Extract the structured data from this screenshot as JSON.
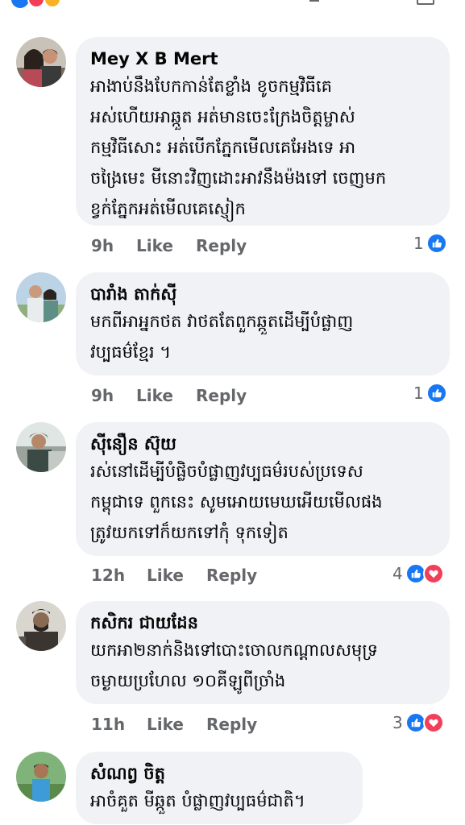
{
  "colors": {
    "like": "#1877f2",
    "love": "#f33e58",
    "bubble": "#f0f2f5",
    "meta": "#65676b"
  },
  "comments": [
    {
      "author": "Mey X B Mert",
      "text": "អាងាប់នឹងបែកកាន់តែខ្លាំង ខូចកម្មវិធីគេ\nអស់ហើយអាឆ្កួត អត់មានចេះក្រែងចិត្តម្ចាស់\nកម្មវិធីសោះ អត់បើកភ្នែកមើលគេអែងទេ អា\nចង្រៃមេះ មីនោះវិញដោះអាវនឹងម៉ងទៅ ចេញមក\nខ្វក់ភ្នែកអត់មើលគេស្ញៀក",
      "time": "9h",
      "like": "Like",
      "reply": "Reply",
      "reaction_count": "1",
      "reactions": [
        "like-icon"
      ]
    },
    {
      "author": "បារាំង តាក់ស៊ី",
      "text": "មកពីអាអ្នកថត វាថតតែពួកឆ្កួតដើម្បីបំផ្លាញ\nវប្បធម៌ខ្មែរ ។",
      "time": "9h",
      "like": "Like",
      "reply": "Reply",
      "reaction_count": "1",
      "reactions": [
        "like-icon"
      ]
    },
    {
      "author": "ស៊ីនឿន ស៊ុយ",
      "text": "រស់នៅដើម្បីបំផ្លិចបំផ្លាញវប្បធម៌របស់ប្រទេស\nកម្ពុជាទេ ពួកនេះ សូមអោយមេឃអើយមើលផង\nត្រូវយកទៅក៏យកទៅកុំ ទុកទៀត",
      "time": "12h",
      "like": "Like",
      "reply": "Reply",
      "reaction_count": "4",
      "reactions": [
        "like-icon",
        "love-icon"
      ]
    },
    {
      "author": "កសិករ ជាយដែន",
      "text": "យកអា២នាក់និងទៅបោះចោលកណ្តាលសមុទ្រ\nចម្ងាយប្រហែល ១០គីឡូពីច្រាំង",
      "time": "11h",
      "like": "Like",
      "reply": "Reply",
      "reaction_count": "3",
      "reactions": [
        "like-icon",
        "love-icon"
      ]
    },
    {
      "author": "សំណព្វ ចិត្ត",
      "text": "អាចំគួត  មីឆ្កួត បំផ្លាញវប្បធម៌ជាតិ។",
      "time": "",
      "like": "",
      "reply": "",
      "reaction_count": "",
      "reactions": []
    }
  ]
}
